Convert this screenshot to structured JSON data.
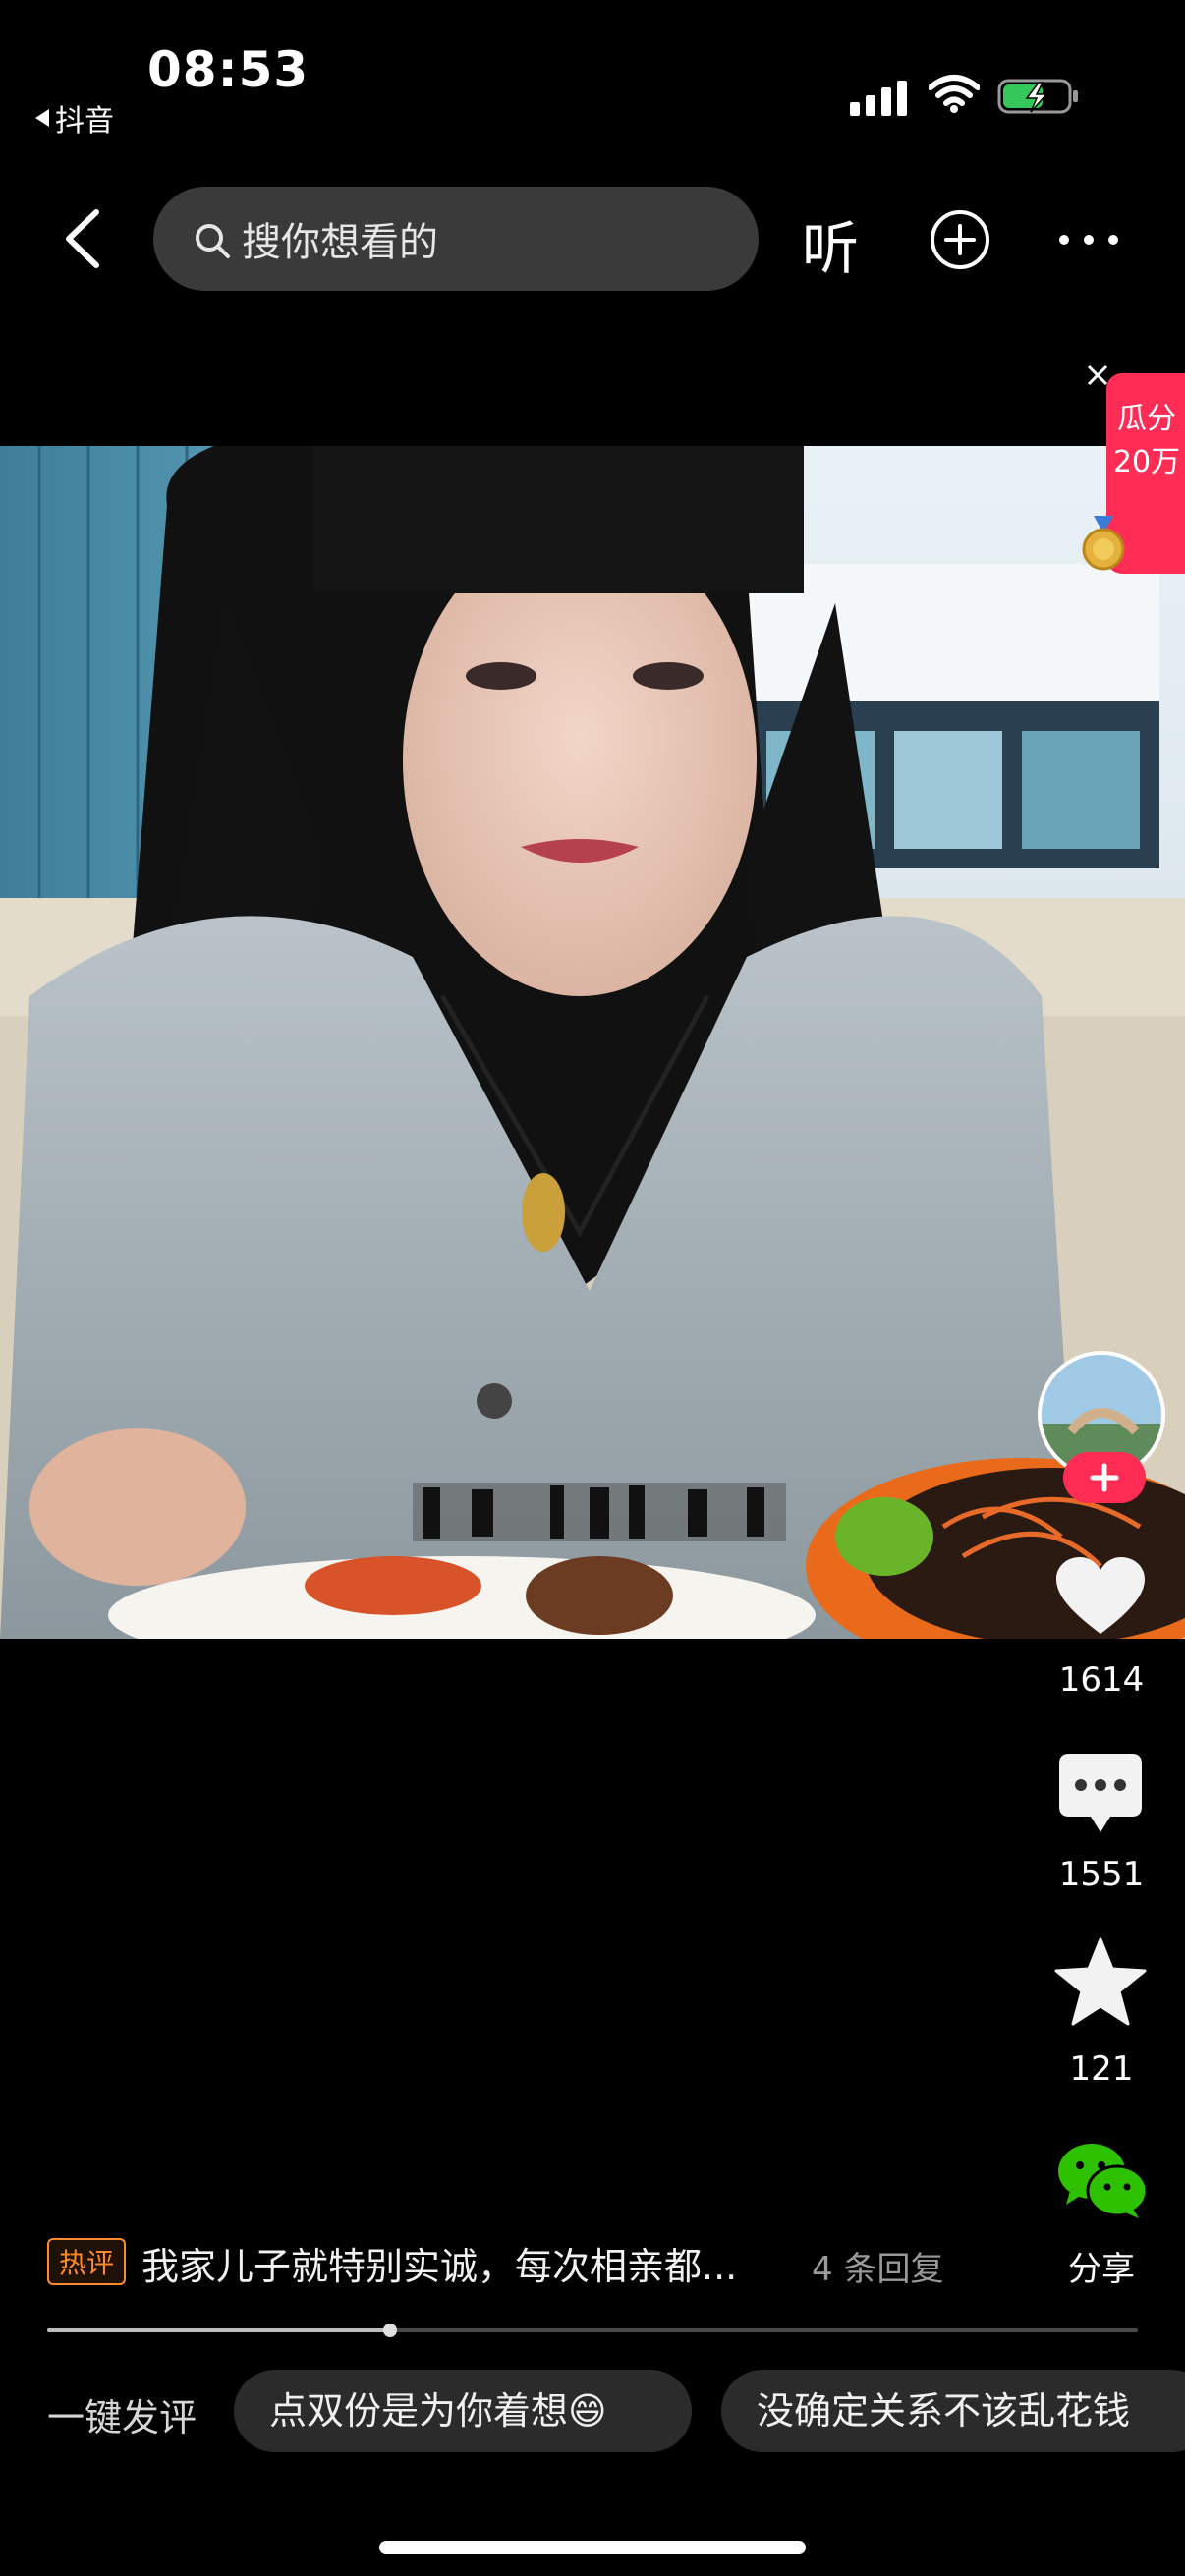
{
  "status_bar": {
    "time": "08:53",
    "back_app_label": "抖音"
  },
  "nav": {
    "search_placeholder": "搜你想看的",
    "listen_label": "听"
  },
  "promo": {
    "text": "瓜分20万"
  },
  "actions": {
    "like_count": "1614",
    "comment_count": "1551",
    "favorite_count": "121",
    "share_label": "分享"
  },
  "hot_comment": {
    "tag": "热评",
    "text": "我家儿子就特别实诚，每次相亲都...",
    "replies": "4 条回复"
  },
  "playback": {
    "progress": 0.314
  },
  "quick_comments": {
    "label": "一键发评",
    "chips": [
      "点双份是为你着想😄",
      "没确定关系不该乱花钱"
    ]
  },
  "colors": {
    "accent_red": "#fe2c55",
    "hot_tag_orange": "#ff8a2a",
    "wechat_green": "#2dc100"
  }
}
